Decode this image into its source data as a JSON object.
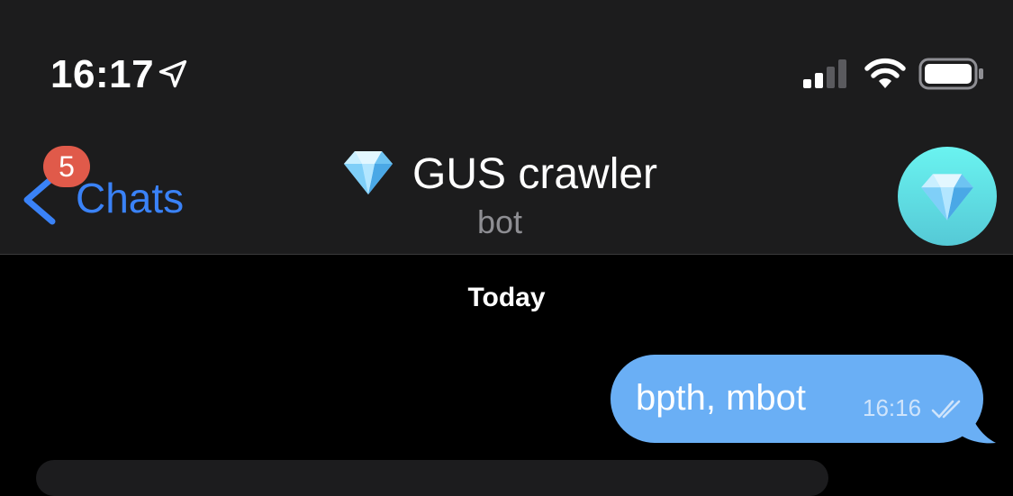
{
  "status_bar": {
    "time": "16:17",
    "icons": [
      "location-arrow-icon",
      "cellular-signal-icon",
      "wifi-icon",
      "battery-icon"
    ]
  },
  "nav": {
    "back_label": "Chats",
    "unread_count": "5",
    "title": "GUS crawler",
    "title_emoji": "gem-icon",
    "subtitle": "bot",
    "avatar": "gem-icon"
  },
  "chat": {
    "date_separator": "Today",
    "messages": [
      {
        "text": "bpth, mbot",
        "time": "16:16",
        "status": "read",
        "outgoing": true
      }
    ]
  },
  "colors": {
    "accent": "#3a82f7",
    "outgoing_bubble": "#6aaff5",
    "badge": "#e05a4a",
    "header_bg": "#1c1c1d",
    "chat_bg": "#000000"
  }
}
